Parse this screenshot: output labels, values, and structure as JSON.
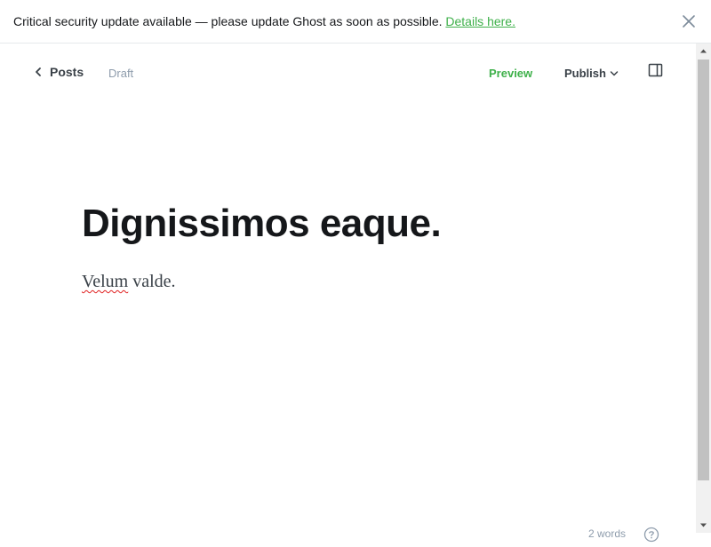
{
  "banner": {
    "message": "Critical security update available — please update Ghost as soon as possible.",
    "link_text": "Details here."
  },
  "editor_header": {
    "back_label": "Posts",
    "status": "Draft",
    "preview_label": "Preview",
    "publish_label": "Publish"
  },
  "post": {
    "title": "Dignissimos eaque.",
    "body_first_word": "Velum",
    "body_rest": " valde."
  },
  "footer": {
    "word_count": "2 words"
  },
  "colors": {
    "accent_green": "#3eb04a",
    "text_dark": "#15171a",
    "text_muted": "#8e9cac"
  },
  "icons": {
    "banner_close": "close-icon",
    "back": "chevron-left-icon",
    "publish_dropdown": "chevron-down-icon",
    "sidebar": "sidebar-toggle-icon",
    "help": "help-icon"
  }
}
